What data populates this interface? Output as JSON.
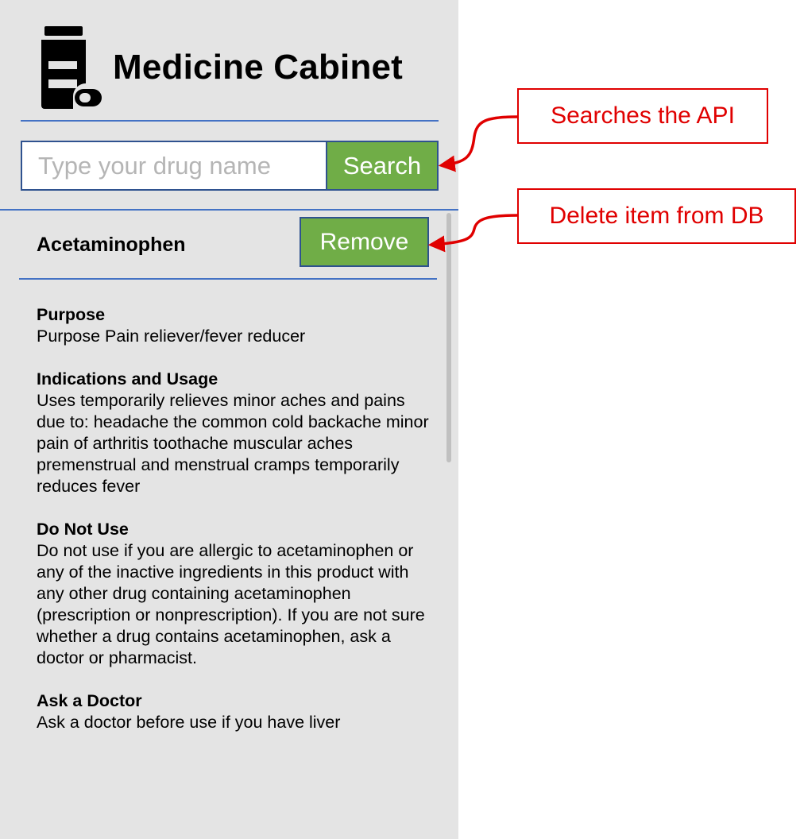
{
  "app": {
    "title": "Medicine Cabinet",
    "logo_icon": "medicine-bottle-icon"
  },
  "search": {
    "placeholder": "Type your drug name",
    "button_label": "Search"
  },
  "item": {
    "title": "Acetaminophen",
    "remove_label": "Remove",
    "sections": [
      {
        "heading": "Purpose",
        "body": "Purpose Pain reliever/fever reducer"
      },
      {
        "heading": "Indications and Usage",
        "body": "Uses temporarily relieves minor aches and pains due to: headache the common cold backache minor pain of arthritis toothache muscular aches premenstrual and menstrual cramps temporarily reduces fever"
      },
      {
        "heading": "Do Not Use",
        "body": "Do not use if you are allergic to acetaminophen or any of the inactive ingredients in this product with any other drug containing acetaminophen (prescription or nonprescription). If you are not sure whether a drug contains acetaminophen, ask a doctor or pharmacist."
      },
      {
        "heading": "Ask a Doctor",
        "body": "Ask a doctor before use if you have liver"
      }
    ]
  },
  "annotations": {
    "search_note": "Searches the API",
    "remove_note": "Delete item from DB"
  },
  "colors": {
    "panel_background": "#e4e4e4",
    "button_green": "#70ad47",
    "rule_blue": "#4472c4",
    "annotation_red": "#e00000"
  }
}
